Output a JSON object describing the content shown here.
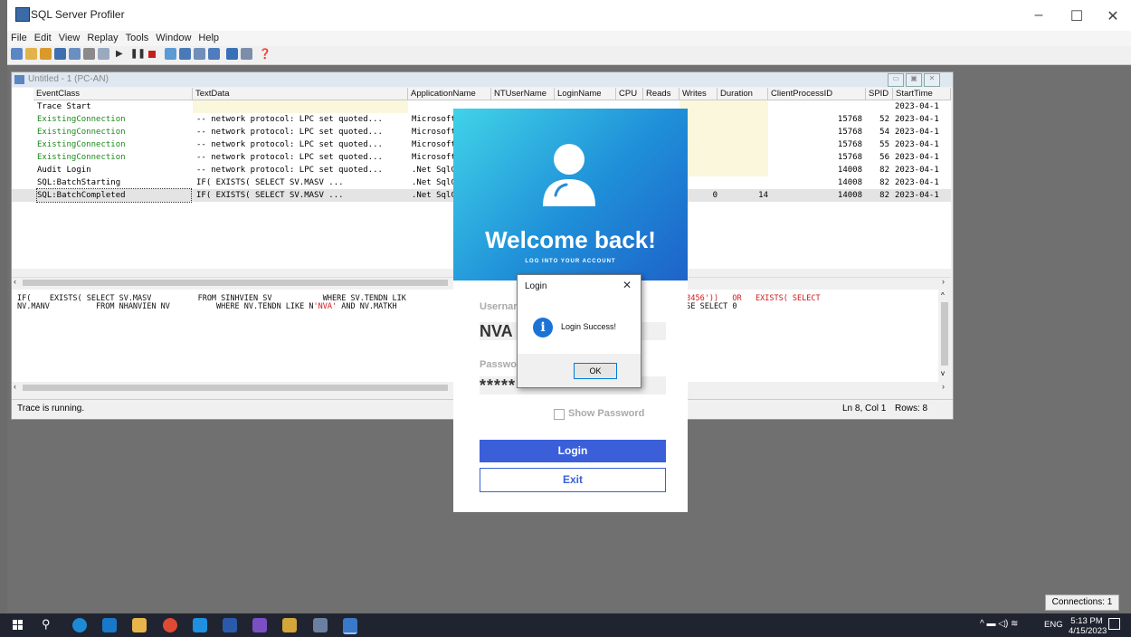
{
  "app": {
    "title": "SQL Server Profiler",
    "menu": [
      "File",
      "Edit",
      "View",
      "Replay",
      "Tools",
      "Window",
      "Help"
    ],
    "connections": "Connections: 1"
  },
  "trace": {
    "title": "Untitled - 1 (PC-AN)",
    "columns": [
      "EventClass",
      "TextData",
      "ApplicationName",
      "NTUserName",
      "LoginName",
      "CPU",
      "Reads",
      "Writes",
      "Duration",
      "ClientProcessID",
      "SPID",
      "StartTime"
    ],
    "rows": [
      {
        "event": "Trace Start",
        "text": "",
        "app": "",
        "reads": "",
        "writes": "",
        "duration": "",
        "cpid": "",
        "spid": "",
        "start": "2023-04-1"
      },
      {
        "event": "ExistingConnection",
        "text": "-- network protocol: LPC  set quoted...",
        "app": "Microsoft",
        "reads": "",
        "writes": "",
        "duration": "",
        "cpid": "15768",
        "spid": "52",
        "start": "2023-04-1"
      },
      {
        "event": "ExistingConnection",
        "text": "-- network protocol: LPC  set quoted...",
        "app": "Microsoft",
        "reads": "",
        "writes": "",
        "duration": "",
        "cpid": "15768",
        "spid": "54",
        "start": "2023-04-1"
      },
      {
        "event": "ExistingConnection",
        "text": "-- network protocol: LPC  set quoted...",
        "app": "Microsoft",
        "reads": "",
        "writes": "",
        "duration": "",
        "cpid": "15768",
        "spid": "55",
        "start": "2023-04-1"
      },
      {
        "event": "ExistingConnection",
        "text": "-- network protocol: LPC  set quoted...",
        "app": "Microsoft",
        "reads": "",
        "writes": "",
        "duration": "",
        "cpid": "15768",
        "spid": "56",
        "start": "2023-04-1"
      },
      {
        "event": "Audit Login",
        "text": "-- network protocol: LPC  set quoted...",
        "app": ".Net SqlC",
        "reads": "",
        "writes": "",
        "duration": "",
        "cpid": "14008",
        "spid": "82",
        "start": "2023-04-1"
      },
      {
        "event": "SQL:BatchStarting",
        "text": "IF(   EXISTS( SELECT SV.MASV        ...",
        "app": ".Net SqlC",
        "reads": "",
        "writes": "",
        "duration": "",
        "cpid": "14008",
        "spid": "82",
        "start": "2023-04-1"
      },
      {
        "event": "SQL:BatchCompleted",
        "text": "IF(   EXISTS( SELECT SV.MASV        ...",
        "app": ".Net SqlC",
        "reads": "",
        "writes": "0",
        "duration": "14",
        "cpid": "14008",
        "spid": "82",
        "start": "2023-04-1"
      }
    ],
    "sql_line1_a": "IF(    EXISTS( SELECT SV.MASV          FROM SINHVIEN SV           WHERE SV.TENDN LIK",
    "sql_line1_b": "123456'))   OR   EXISTS( SELECT",
    "sql_line2_a": "NV.MANV          FROM NHANVIEN NV          WHERE NV.TENDN LIKE N",
    "sql_nva": "'NVA'",
    "sql_line2_b": " AND NV.MATKH",
    "sql_line2_c": "ELSE SELECT 0",
    "status": "Trace is running.",
    "position": "Ln 8, Col 1",
    "rowcount": "Rows: 8"
  },
  "login_form": {
    "welcome": "Welcome back!",
    "subtitle": "LOG INTO YOUR ACCOUNT",
    "username_label": "Usernar",
    "username_value": "NVA",
    "password_label": "Passwo",
    "password_value": "*****",
    "show_password": "Show Password",
    "login_button": "Login",
    "exit_button": "Exit"
  },
  "message_box": {
    "title": "Login",
    "message": "Login Success!",
    "ok": "OK"
  },
  "taskbar": {
    "language": "ENG",
    "time": "5:13 PM",
    "date": "4/15/2023"
  },
  "colors": {
    "accent_blue": "#3b5fd9",
    "event_green": "#1a8a1a",
    "sql_red": "#d01818",
    "banner_start": "#40d3e8",
    "banner_end": "#1e63c9"
  }
}
